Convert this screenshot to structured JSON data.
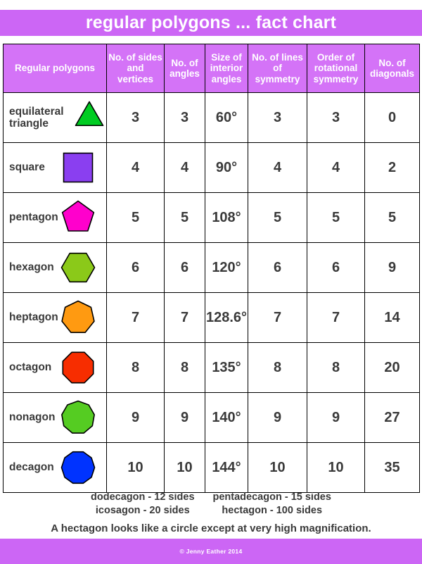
{
  "title": "regular polygons ... fact chart",
  "theme": {
    "header_purple": "#cc66f5",
    "table_header_purple": "#d473f7",
    "text_dark": "#3a3a3a",
    "border": "#000000"
  },
  "table": {
    "columns": [
      {
        "id": "polygon",
        "label": "Regular polygons"
      },
      {
        "id": "sides_vertices",
        "label": "No. of sides and vertices"
      },
      {
        "id": "angles",
        "label": "No. of angles"
      },
      {
        "id": "interior_angle",
        "label": "Size of interior angles"
      },
      {
        "id": "lines_symmetry",
        "label": "No. of lines of symmetry"
      },
      {
        "id": "rotational_symmetry",
        "label": "Order of rotational symmetry"
      },
      {
        "id": "diagonals",
        "label": "No. of diagonals"
      }
    ],
    "rows": [
      {
        "name": "equilateral triangle",
        "shape": "triangle-icon",
        "sides": 3,
        "color": "#00cc22",
        "sides_vertices": "3",
        "angles": "3",
        "interior_angle": "60°",
        "lines_symmetry": "3",
        "rotational_symmetry": "3",
        "diagonals": "0"
      },
      {
        "name": "square",
        "shape": "square-icon",
        "sides": 4,
        "color": "#8a3ff0",
        "sides_vertices": "4",
        "angles": "4",
        "interior_angle": "90°",
        "lines_symmetry": "4",
        "rotational_symmetry": "4",
        "diagonals": "2"
      },
      {
        "name": "pentagon",
        "shape": "pentagon-icon",
        "sides": 5,
        "color": "#ff00cc",
        "sides_vertices": "5",
        "angles": "5",
        "interior_angle": "108°",
        "lines_symmetry": "5",
        "rotational_symmetry": "5",
        "diagonals": "5"
      },
      {
        "name": "hexagon",
        "shape": "hexagon-icon",
        "sides": 6,
        "color": "#8bc919",
        "sides_vertices": "6",
        "angles": "6",
        "interior_angle": "120°",
        "lines_symmetry": "6",
        "rotational_symmetry": "6",
        "diagonals": "9"
      },
      {
        "name": "heptagon",
        "shape": "heptagon-icon",
        "sides": 7,
        "color": "#ff9a11",
        "sides_vertices": "7",
        "angles": "7",
        "interior_angle": "128.6°",
        "lines_symmetry": "7",
        "rotational_symmetry": "7",
        "diagonals": "14"
      },
      {
        "name": "octagon",
        "shape": "octagon-icon",
        "sides": 8,
        "color": "#f72d00",
        "sides_vertices": "8",
        "angles": "8",
        "interior_angle": "135°",
        "lines_symmetry": "8",
        "rotational_symmetry": "8",
        "diagonals": "20"
      },
      {
        "name": "nonagon",
        "shape": "nonagon-icon",
        "sides": 9,
        "color": "#55cc22",
        "sides_vertices": "9",
        "angles": "9",
        "interior_angle": "140°",
        "lines_symmetry": "9",
        "rotational_symmetry": "9",
        "diagonals": "27"
      },
      {
        "name": "decagon",
        "shape": "decagon-icon",
        "sides": 10,
        "color": "#0033ff",
        "sides_vertices": "10",
        "angles": "10",
        "interior_angle": "144°",
        "lines_symmetry": "10",
        "rotational_symmetry": "10",
        "diagonals": "35"
      }
    ]
  },
  "notes": {
    "left_column": [
      "dodecagon - 12 sides",
      "icosagon - 20 sides"
    ],
    "right_column": [
      "pentadecagon - 15 sides",
      "hectagon - 100 sides"
    ],
    "sentence": "A hectagon looks like a circle except at very high magnification."
  },
  "footer": {
    "copyright": "© Jenny Eather 2014"
  }
}
